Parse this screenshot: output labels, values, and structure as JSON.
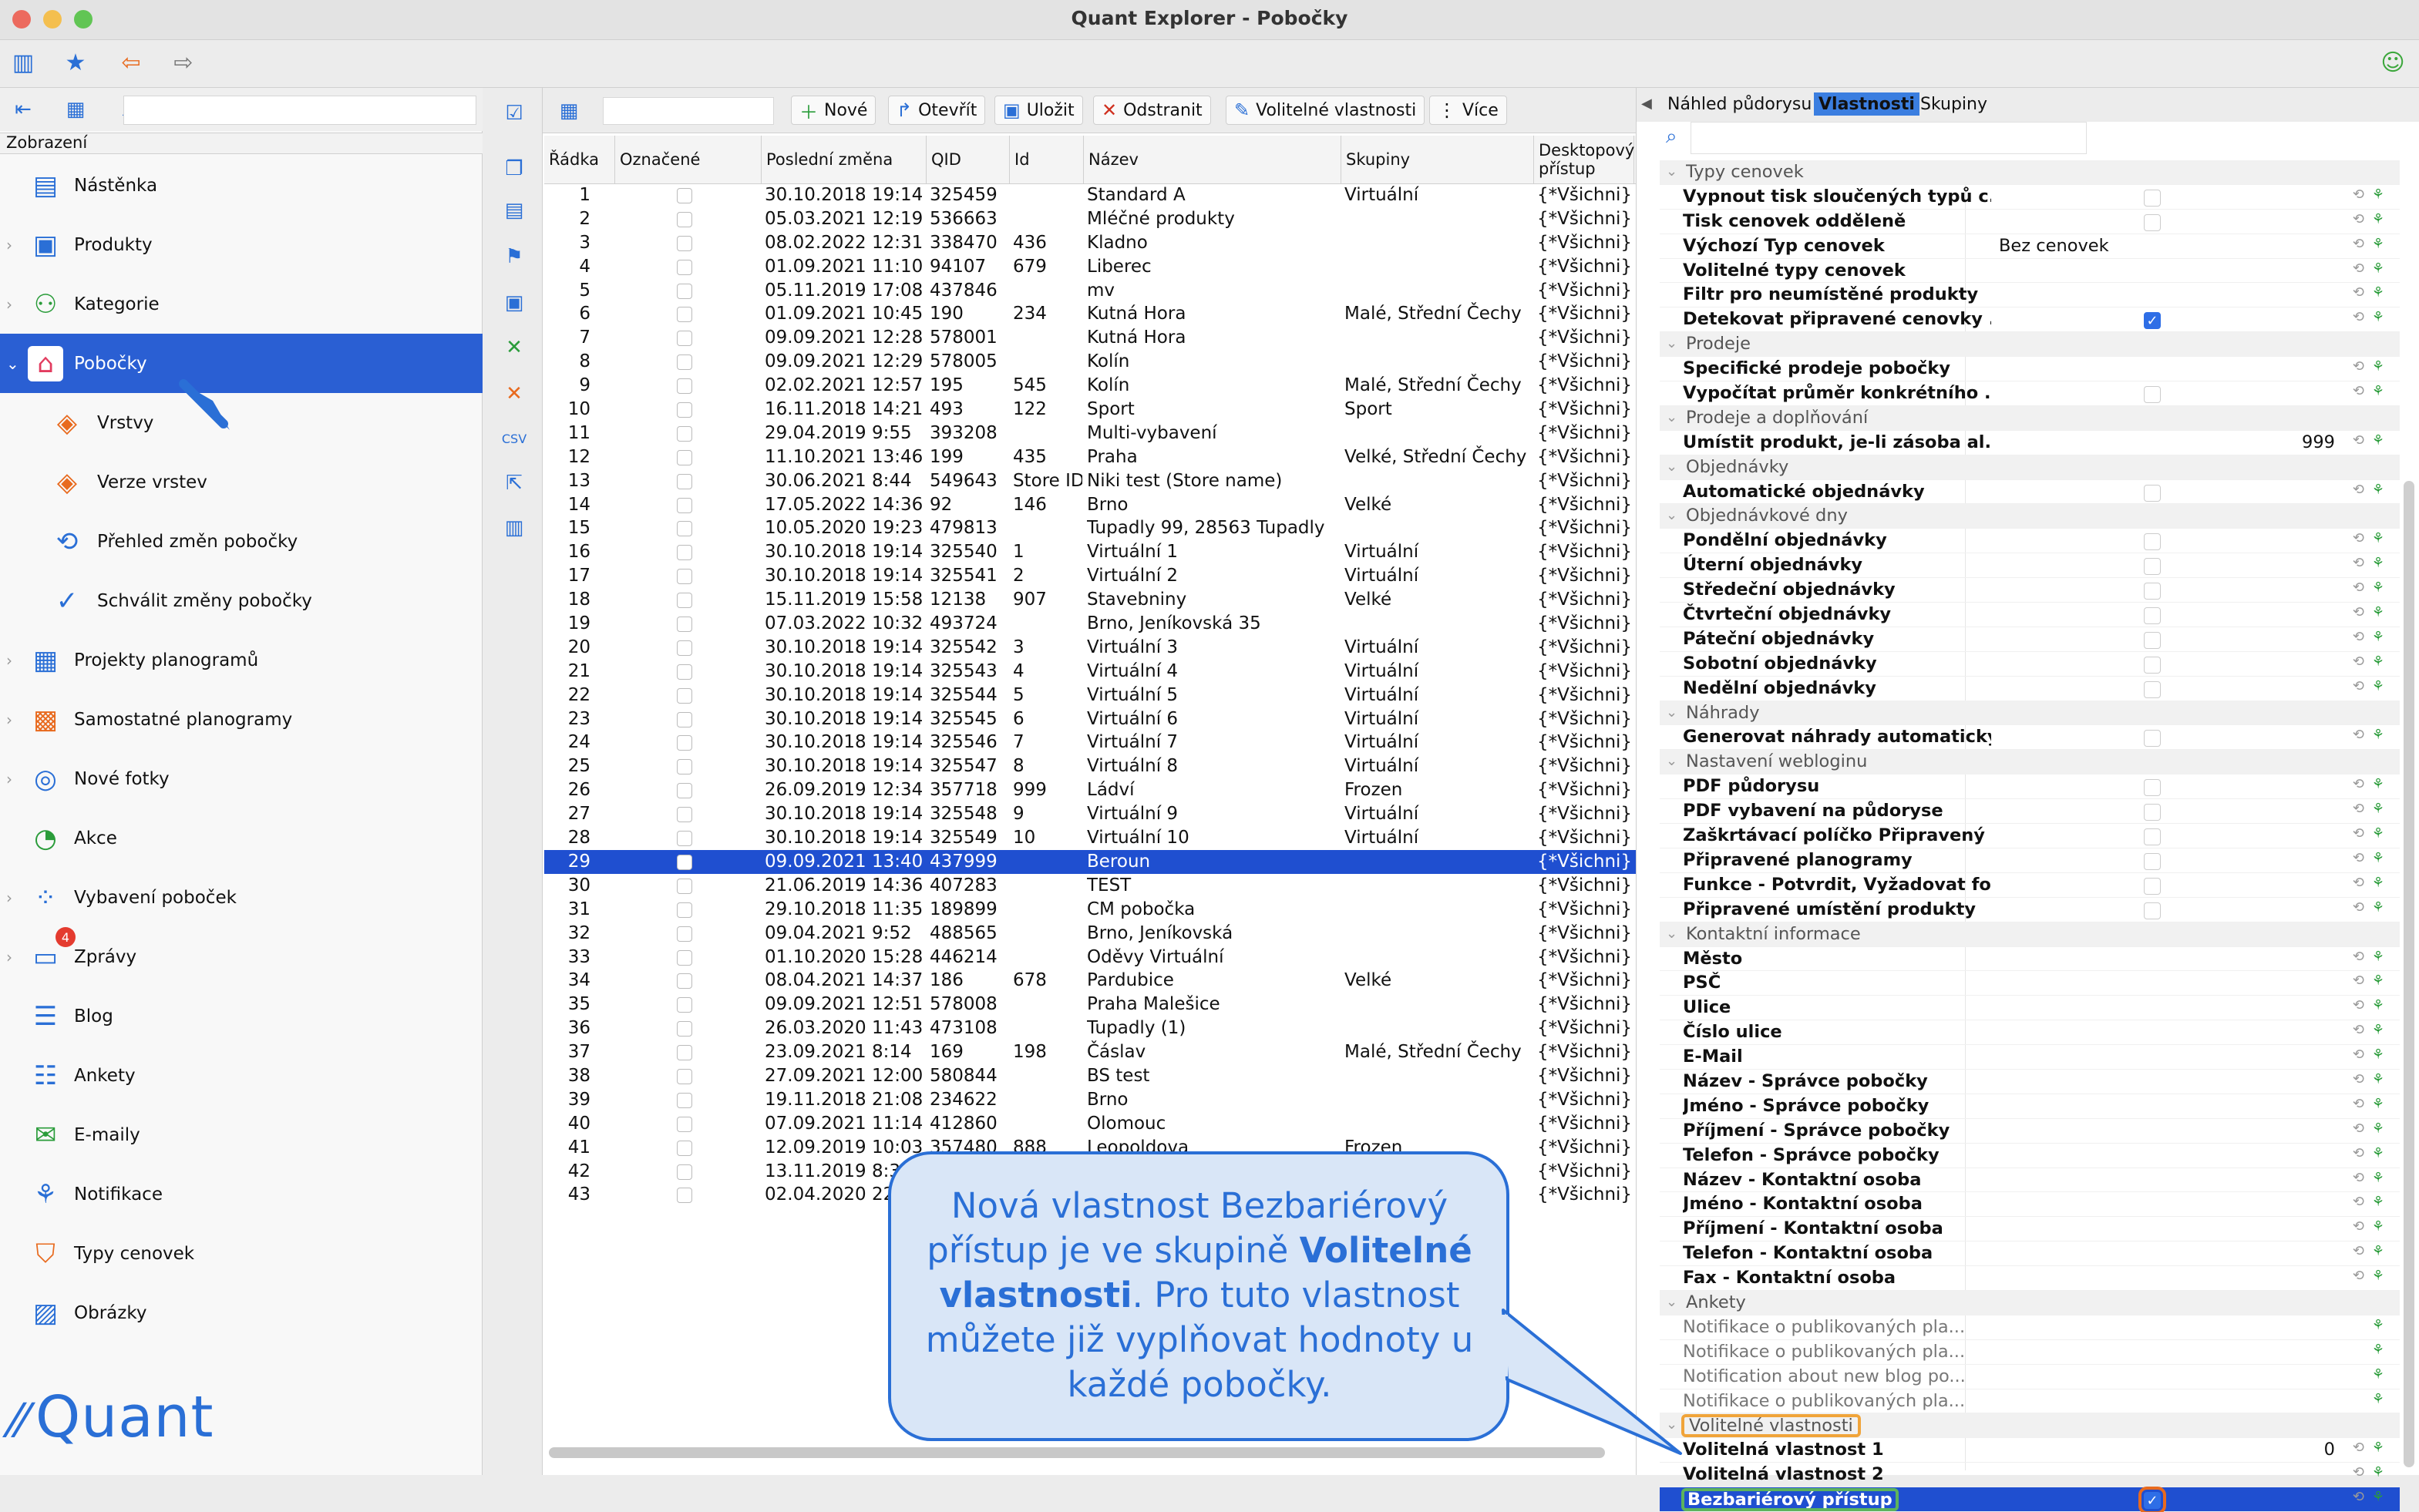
{
  "window": {
    "title": "Quant Explorer - Pobočky"
  },
  "sidebar": {
    "caption": "Zobrazení",
    "items": [
      {
        "label": "Nástěnka",
        "icon": "dashboard-icon",
        "expandable": false
      },
      {
        "label": "Produkty",
        "icon": "product-icon",
        "expandable": true
      },
      {
        "label": "Kategorie",
        "icon": "category-icon",
        "expandable": true
      },
      {
        "label": "Pobočky",
        "icon": "store-icon",
        "expandable": true,
        "selected": true
      },
      {
        "label": "Vrstvy",
        "icon": "layers-icon",
        "child": true
      },
      {
        "label": "Verze vrstev",
        "icon": "layer-versions-icon",
        "child": true
      },
      {
        "label": "Přehled změn pobočky",
        "icon": "store-changes-icon",
        "child": true
      },
      {
        "label": "Schválit změny pobočky",
        "icon": "approve-changes-icon",
        "child": true
      },
      {
        "label": "Projekty planogramů",
        "icon": "planogram-projects-icon",
        "expandable": true
      },
      {
        "label": "Samostatné planogramy",
        "icon": "planograms-icon",
        "expandable": true
      },
      {
        "label": "Nové fotky",
        "icon": "camera-icon",
        "expandable": true
      },
      {
        "label": "Akce",
        "icon": "promo-icon",
        "expandable": false
      },
      {
        "label": "Vybavení poboček",
        "icon": "equipment-icon",
        "expandable": true
      },
      {
        "label": "Zprávy",
        "icon": "messages-icon",
        "expandable": true,
        "badge": "4"
      },
      {
        "label": "Blog",
        "icon": "blog-icon",
        "expandable": false
      },
      {
        "label": "Ankety",
        "icon": "survey-icon",
        "expandable": false
      },
      {
        "label": "E-maily",
        "icon": "email-icon",
        "expandable": false
      },
      {
        "label": "Notifikace",
        "icon": "notification-icon",
        "expandable": false
      },
      {
        "label": "Typy cenovek",
        "icon": "price-tag-icon",
        "expandable": false
      },
      {
        "label": "Obrázky",
        "icon": "image-icon",
        "expandable": false
      }
    ],
    "logo": "Quant"
  },
  "toolbar": {
    "new": "Nové",
    "open": "Otevřít",
    "save": "Uložit",
    "delete": "Odstranit",
    "custom_props": "Volitelné vlastnosti",
    "more": "Více"
  },
  "table": {
    "columns": [
      "Řádka",
      "Označené",
      "Poslední změna",
      "QID",
      "Id",
      "Název",
      "Skupiny",
      "Desktopový přístup"
    ],
    "selected_row": 29,
    "rows": [
      [
        "1",
        "30.10.2018 19:14",
        "325459",
        "",
        "Standard A",
        "Virtuální",
        "{*Všichni}"
      ],
      [
        "2",
        "05.03.2021 12:19",
        "536663",
        "",
        "Mléčné produkty",
        "",
        "{*Všichni}"
      ],
      [
        "3",
        "08.02.2022 12:31",
        "338470",
        "436",
        "Kladno",
        "",
        "{*Všichni}"
      ],
      [
        "4",
        "01.09.2021 11:10",
        "94107",
        "679",
        "Liberec",
        "",
        "{*Všichni}"
      ],
      [
        "5",
        "05.11.2019 17:08",
        "437846",
        "",
        "mv",
        "",
        "{*Všichni}"
      ],
      [
        "6",
        "01.09.2021 10:45",
        "190",
        "234",
        "Kutná Hora",
        "Malé, Střední Čechy",
        "{*Všichni}"
      ],
      [
        "7",
        "09.09.2021 12:28",
        "578001",
        "",
        "Kutná Hora",
        "",
        "{*Všichni}"
      ],
      [
        "8",
        "09.09.2021 12:29",
        "578005",
        "",
        "Kolín",
        "",
        "{*Všichni}"
      ],
      [
        "9",
        "02.02.2021 12:57",
        "195",
        "545",
        "Kolín",
        "Malé, Střední Čechy",
        "{*Všichni}"
      ],
      [
        "10",
        "16.11.2018 14:21",
        "493",
        "122",
        "Sport",
        "Sport",
        "{*Všichni}"
      ],
      [
        "11",
        "29.04.2019 9:55",
        "393208",
        "",
        "Multi-vybavení",
        "",
        "{*Všichni}"
      ],
      [
        "12",
        "11.10.2021 13:46",
        "199",
        "435",
        "Praha",
        "Velké, Střední Čechy",
        "{*Všichni}"
      ],
      [
        "13",
        "30.06.2021 8:44",
        "549643",
        "Store ID",
        "Niki test (Store name)",
        "",
        "{*Všichni}"
      ],
      [
        "14",
        "17.05.2022 14:36",
        "92",
        "146",
        "Brno",
        "Velké",
        "{*Všichni}"
      ],
      [
        "15",
        "10.05.2020 19:23",
        "479813",
        "",
        "Tupadly 99, 28563 Tupadly",
        "",
        "{*Všichni}"
      ],
      [
        "16",
        "30.10.2018 19:14",
        "325540",
        "1",
        "Virtuální 1",
        "Virtuální",
        "{*Všichni}"
      ],
      [
        "17",
        "30.10.2018 19:14",
        "325541",
        "2",
        "Virtuální 2",
        "Virtuální",
        "{*Všichni}"
      ],
      [
        "18",
        "15.11.2019 15:58",
        "12138",
        "907",
        "Stavebniny",
        "Velké",
        "{*Všichni}"
      ],
      [
        "19",
        "07.03.2022 10:32",
        "493724",
        "",
        "Brno, Jeníkovská 35",
        "",
        "{*Všichni}"
      ],
      [
        "20",
        "30.10.2018 19:14",
        "325542",
        "3",
        "Virtuální 3",
        "Virtuální",
        "{*Všichni}"
      ],
      [
        "21",
        "30.10.2018 19:14",
        "325543",
        "4",
        "Virtuální 4",
        "Virtuální",
        "{*Všichni}"
      ],
      [
        "22",
        "30.10.2018 19:14",
        "325544",
        "5",
        "Virtuální 5",
        "Virtuální",
        "{*Všichni}"
      ],
      [
        "23",
        "30.10.2018 19:14",
        "325545",
        "6",
        "Virtuální 6",
        "Virtuální",
        "{*Všichni}"
      ],
      [
        "24",
        "30.10.2018 19:14",
        "325546",
        "7",
        "Virtuální 7",
        "Virtuální",
        "{*Všichni}"
      ],
      [
        "25",
        "30.10.2018 19:14",
        "325547",
        "8",
        "Virtuální 8",
        "Virtuální",
        "{*Všichni}"
      ],
      [
        "26",
        "26.09.2019 12:34",
        "357718",
        "999",
        "Ládví",
        "Frozen",
        "{*Všichni}"
      ],
      [
        "27",
        "30.10.2018 19:14",
        "325548",
        "9",
        "Virtuální 9",
        "Virtuální",
        "{*Všichni}"
      ],
      [
        "28",
        "30.10.2018 19:14",
        "325549",
        "10",
        "Virtuální 10",
        "Virtuální",
        "{*Všichni}"
      ],
      [
        "29",
        "09.09.2021 13:40",
        "437999",
        "",
        "Beroun",
        "",
        "{*Všichni}"
      ],
      [
        "30",
        "21.06.2019 14:36",
        "407283",
        "",
        "TEST",
        "",
        "{*Všichni}"
      ],
      [
        "31",
        "29.10.2018 11:35",
        "189899",
        "",
        "CM pobočka",
        "",
        "{*Všichni}"
      ],
      [
        "32",
        "09.04.2021 9:52",
        "488565",
        "",
        "Brno, Jeníkovská",
        "",
        "{*Všichni}"
      ],
      [
        "33",
        "01.10.2020 15:28",
        "446214",
        "",
        "Oděvy Virtuální",
        "",
        "{*Všichni}"
      ],
      [
        "34",
        "08.04.2021 14:37",
        "186",
        "678",
        "Pardubice",
        "Velké",
        "{*Všichni}"
      ],
      [
        "35",
        "09.09.2021 12:51",
        "578008",
        "",
        "Praha Malešice",
        "",
        "{*Všichni}"
      ],
      [
        "36",
        "26.03.2020 11:43",
        "473108",
        "",
        "Tupadly (1)",
        "",
        "{*Všichni}"
      ],
      [
        "37",
        "23.09.2021 8:14",
        "169",
        "198",
        "Čáslav",
        "Malé, Střední Čechy",
        "{*Všichni}"
      ],
      [
        "38",
        "27.09.2021 12:00",
        "580844",
        "",
        "BS test",
        "",
        "{*Všichni}"
      ],
      [
        "39",
        "19.11.2018 21:08",
        "234622",
        "",
        "Brno",
        "",
        "{*Všichni}"
      ],
      [
        "40",
        "07.09.2021 11:14",
        "412860",
        "",
        "Olomouc",
        "",
        "{*Všichni}"
      ],
      [
        "41",
        "12.09.2019 10:03",
        "357480",
        "888",
        "Leopoldova",
        "Frozen",
        "{*Všichni}"
      ],
      [
        "42",
        "13.11.2019 8:3",
        "",
        "",
        "",
        "",
        "{*Všichni}"
      ],
      [
        "43",
        "02.04.2020 22",
        "",
        "",
        "",
        "",
        "{*Všichni}"
      ]
    ]
  },
  "right_panel": {
    "tabs": [
      "Náhled půdorysu",
      "Vlastnosti",
      "Skupiny"
    ],
    "active_tab": "Vlastnosti",
    "rows": [
      {
        "type": "group",
        "label": "Typy cenovek"
      },
      {
        "label": "Vypnout tisk sloučených typů c...",
        "cb": false
      },
      {
        "label": "Tisk cenovek odděleně",
        "cb": false
      },
      {
        "label": "Výchozí Typ cenovek",
        "value": "Bez cenovek"
      },
      {
        "label": "Volitelné typy cenovek"
      },
      {
        "label": "Filtr pro neumístěné produkty"
      },
      {
        "label": "Detekovat připravené cenovky ...",
        "cb": true
      },
      {
        "type": "group",
        "label": "Prodeje"
      },
      {
        "label": "Specifické prodeje pobočky"
      },
      {
        "label": "Vypočítat průměr konkrétního ...",
        "cb": false
      },
      {
        "type": "group",
        "label": "Prodeje a doplňování"
      },
      {
        "label": "Umístit produkt, je-li zásoba al...",
        "rvalue": "999"
      },
      {
        "type": "group",
        "label": "Objednávky"
      },
      {
        "label": "Automatické objednávky",
        "cb": false
      },
      {
        "type": "group",
        "label": "Objednávkové dny"
      },
      {
        "label": "Pondělní objednávky",
        "cb": false
      },
      {
        "label": "Úterní objednávky",
        "cb": false
      },
      {
        "label": "Středeční objednávky",
        "cb": false
      },
      {
        "label": "Čtvrteční objednávky",
        "cb": false
      },
      {
        "label": "Páteční objednávky",
        "cb": false
      },
      {
        "label": "Sobotní objednávky",
        "cb": false
      },
      {
        "label": "Nedělní objednávky",
        "cb": false
      },
      {
        "type": "group",
        "label": "Náhrady"
      },
      {
        "label": "Generovat náhrady automaticky",
        "cb": false
      },
      {
        "type": "group",
        "label": "Nastavení webloginu"
      },
      {
        "label": "PDF půdorysu",
        "cb": false
      },
      {
        "label": "PDF vybavení na půdoryse",
        "cb": false
      },
      {
        "label": "Zaškrtávací políčko Připravený",
        "cb": false
      },
      {
        "label": "Připravené planogramy",
        "cb": false
      },
      {
        "label": "Funkce - Potvrdit, Vyžadovat fo...",
        "cb": false
      },
      {
        "label": "Připravené umístění produkty",
        "cb": false
      },
      {
        "type": "group",
        "label": "Kontaktní informace"
      },
      {
        "label": "Město"
      },
      {
        "label": "PSČ"
      },
      {
        "label": "Ulice"
      },
      {
        "label": "Číslo ulice"
      },
      {
        "label": "E-Mail"
      },
      {
        "label": "Název - Správce pobočky"
      },
      {
        "label": "Jméno - Správce pobočky"
      },
      {
        "label": "Příjmení - Správce pobočky"
      },
      {
        "label": "Telefon - Správce pobočky"
      },
      {
        "label": "Název - Kontaktní osoba"
      },
      {
        "label": "Jméno - Kontaktní osoba"
      },
      {
        "label": "Příjmení - Kontaktní osoba"
      },
      {
        "label": "Telefon - Kontaktní osoba"
      },
      {
        "label": "Fax - Kontaktní osoba"
      },
      {
        "type": "group",
        "label": "Ankety"
      },
      {
        "label": "Notifikace o publikovaných pla...",
        "dim": true
      },
      {
        "label": "Notifikace o publikovaných pla...",
        "dim": true
      },
      {
        "label": "Notification about new blog po...",
        "dim": true
      },
      {
        "label": "Notifikace o publikovaných pla...",
        "dim": true
      },
      {
        "type": "group",
        "label": "Volitelné vlastnosti",
        "highlight": "orange"
      },
      {
        "label": "Volitelná vlastnost 1",
        "rvalue": "0"
      },
      {
        "label": "Volitelná vlastnost 2"
      },
      {
        "label": "Bezbariérový přístup",
        "cb": true,
        "selected": true,
        "highlight": "green"
      }
    ]
  },
  "callout": {
    "text_1": "Nová vlastnost Bezbariérový přístup je ve skupině ",
    "text_bold_1": "Volitelné vlastnosti",
    "text_2": ". Pro tuto vlastnost můžete již vyplňovat hodnoty u každé pobočky."
  },
  "colors": {
    "accent": "#2a6fd6",
    "selection": "#1f4fd0",
    "callout_bg": "#d9e6f7",
    "highlight_orange": "#f0a43a",
    "highlight_green": "#5db35d"
  }
}
